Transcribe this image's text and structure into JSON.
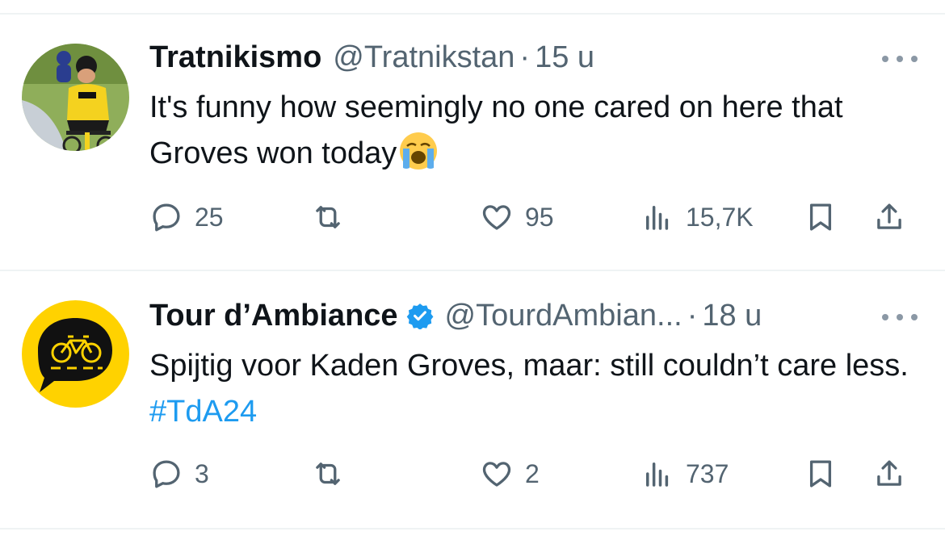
{
  "tweets": [
    {
      "display_name": "Tratnikismo",
      "handle": "@Tratnikstan",
      "separator": "·",
      "time": "15 u",
      "verified": false,
      "text": "It's funny how seemingly no one cared on here that Groves won today",
      "emoji": "loudly-crying-face",
      "hashtag": "",
      "replies": "25",
      "retweets": "",
      "likes": "95",
      "views": "15,7K"
    },
    {
      "display_name": "Tour d’Ambiance",
      "handle": "@TourdAmbian...",
      "separator": "·",
      "time": "18 u",
      "verified": true,
      "text": "Spijtig voor Kaden Groves, maar: still couldn’t care less. ",
      "hashtag": "#TdA24",
      "replies": "3",
      "retweets": "",
      "likes": "2",
      "views": "737"
    }
  ],
  "colors": {
    "text": "#0f1419",
    "secondary": "#536471",
    "link": "#1d9bf0",
    "verified": "#1d9bf0",
    "divider": "#eff3f4",
    "avatar2_bg": "#ffd200"
  },
  "icons": [
    "reply-icon",
    "retweet-icon",
    "like-icon",
    "views-icon",
    "bookmark-icon",
    "share-icon",
    "more-icon",
    "verified-badge-icon"
  ]
}
